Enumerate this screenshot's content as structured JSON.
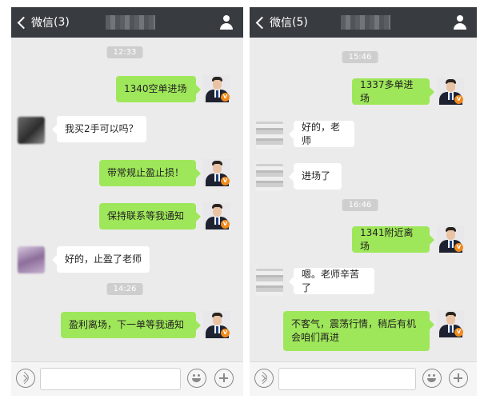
{
  "left": {
    "back_label": "微信",
    "unread": "(3)",
    "messages": {
      "t1": "12:33",
      "m1": "1340空单进场",
      "m2": "我买2手可以吗？",
      "m3": "带常规止盈止损！",
      "m4": "保持联系等我通知",
      "m5": "好的，止盈了老师",
      "t2": "14:26",
      "m6": "盈利离场，下一单等我通知"
    }
  },
  "right": {
    "back_label": "微信",
    "unread": "(5)",
    "messages": {
      "t1": "15:46",
      "m1": "1337多单进场",
      "m2": "好的，老师",
      "m3": "进场了",
      "t2": "16:46",
      "m4": "1341附近离场",
      "m5": "嗯。老师辛苦了",
      "m6a": "不客气，震荡行情，稍后有机",
      "m6b": "会咱们再进"
    }
  },
  "icons": {
    "back": "chevron-left-icon",
    "profile": "person-icon",
    "voice": "voice-icon",
    "emoji": "emoji-icon",
    "plus": "plus-icon"
  },
  "colors": {
    "header_bg": "#383c40",
    "chat_bg": "#ebebeb",
    "sent_bubble": "#9fe75a",
    "received_bubble": "#ffffff",
    "avatar_badge": "#f08a1c"
  }
}
